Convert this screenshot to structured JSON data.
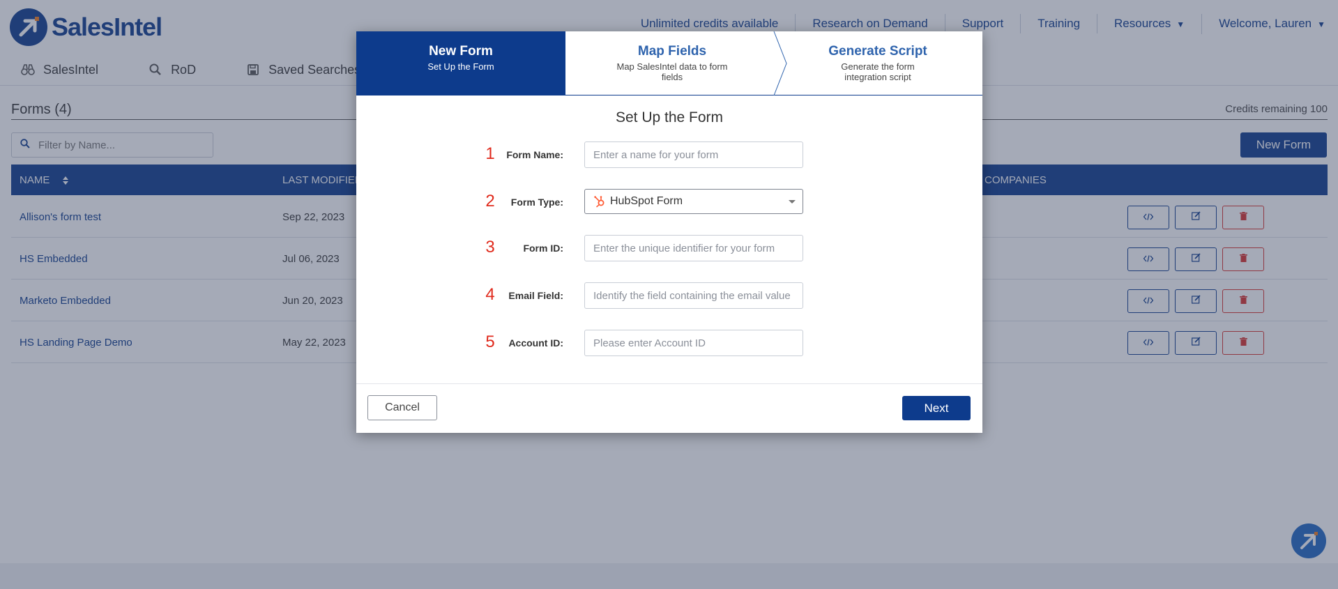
{
  "app": {
    "brand": "SalesIntel",
    "top_nav": [
      {
        "label": "Unlimited credits available"
      },
      {
        "label": "Research on Demand"
      },
      {
        "label": "Support"
      },
      {
        "label": "Training"
      },
      {
        "label": "Resources"
      },
      {
        "label": "Welcome, Lauren"
      }
    ],
    "sub_nav": [
      {
        "label": "SalesIntel",
        "icon": "binoculars-icon"
      },
      {
        "label": "RoD",
        "icon": "search-icon"
      },
      {
        "label": "Saved Searches",
        "icon": "save-icon"
      }
    ],
    "forms_title": "Forms (4)",
    "credits": "Credits remaining 100",
    "filter_placeholder": "Filter by Name...",
    "new_form_label": "New Form",
    "columns": {
      "name": "NAME",
      "last_modified": "LAST MODIFIED",
      "companies": "COMPANIES"
    },
    "rows": [
      {
        "name": "Allison's form test",
        "date": "Sep 22, 2023"
      },
      {
        "name": "HS Embedded",
        "date": "Jul 06, 2023"
      },
      {
        "name": "Marketo Embedded",
        "date": "Jun 20, 2023"
      },
      {
        "name": "HS Landing Page Demo",
        "date": "May 22, 2023"
      }
    ]
  },
  "modal": {
    "steps": [
      {
        "title": "New Form",
        "subtitle": "Set Up the Form"
      },
      {
        "title": "Map Fields",
        "subtitle": "Map SalesIntel data to form fields"
      },
      {
        "title": "Generate Script",
        "subtitle": "Generate the form integration script"
      }
    ],
    "title": "Set Up the Form",
    "fields": [
      {
        "num": "1",
        "label": "Form Name:",
        "placeholder": "Enter a name for your form"
      },
      {
        "num": "2",
        "label": "Form Type:",
        "value": "HubSpot Form"
      },
      {
        "num": "3",
        "label": "Form ID:",
        "placeholder": "Enter the unique identifier for your form"
      },
      {
        "num": "4",
        "label": "Email Field:",
        "placeholder": "Identify the field containing the email value"
      },
      {
        "num": "5",
        "label": "Account ID:",
        "placeholder": "Please enter Account ID"
      }
    ],
    "cancel_label": "Cancel",
    "next_label": "Next"
  },
  "colors": {
    "brand": "#0d3b8c",
    "step_link": "#2e63ad",
    "annotation": "#e02a1c",
    "delete": "#d9302c"
  }
}
